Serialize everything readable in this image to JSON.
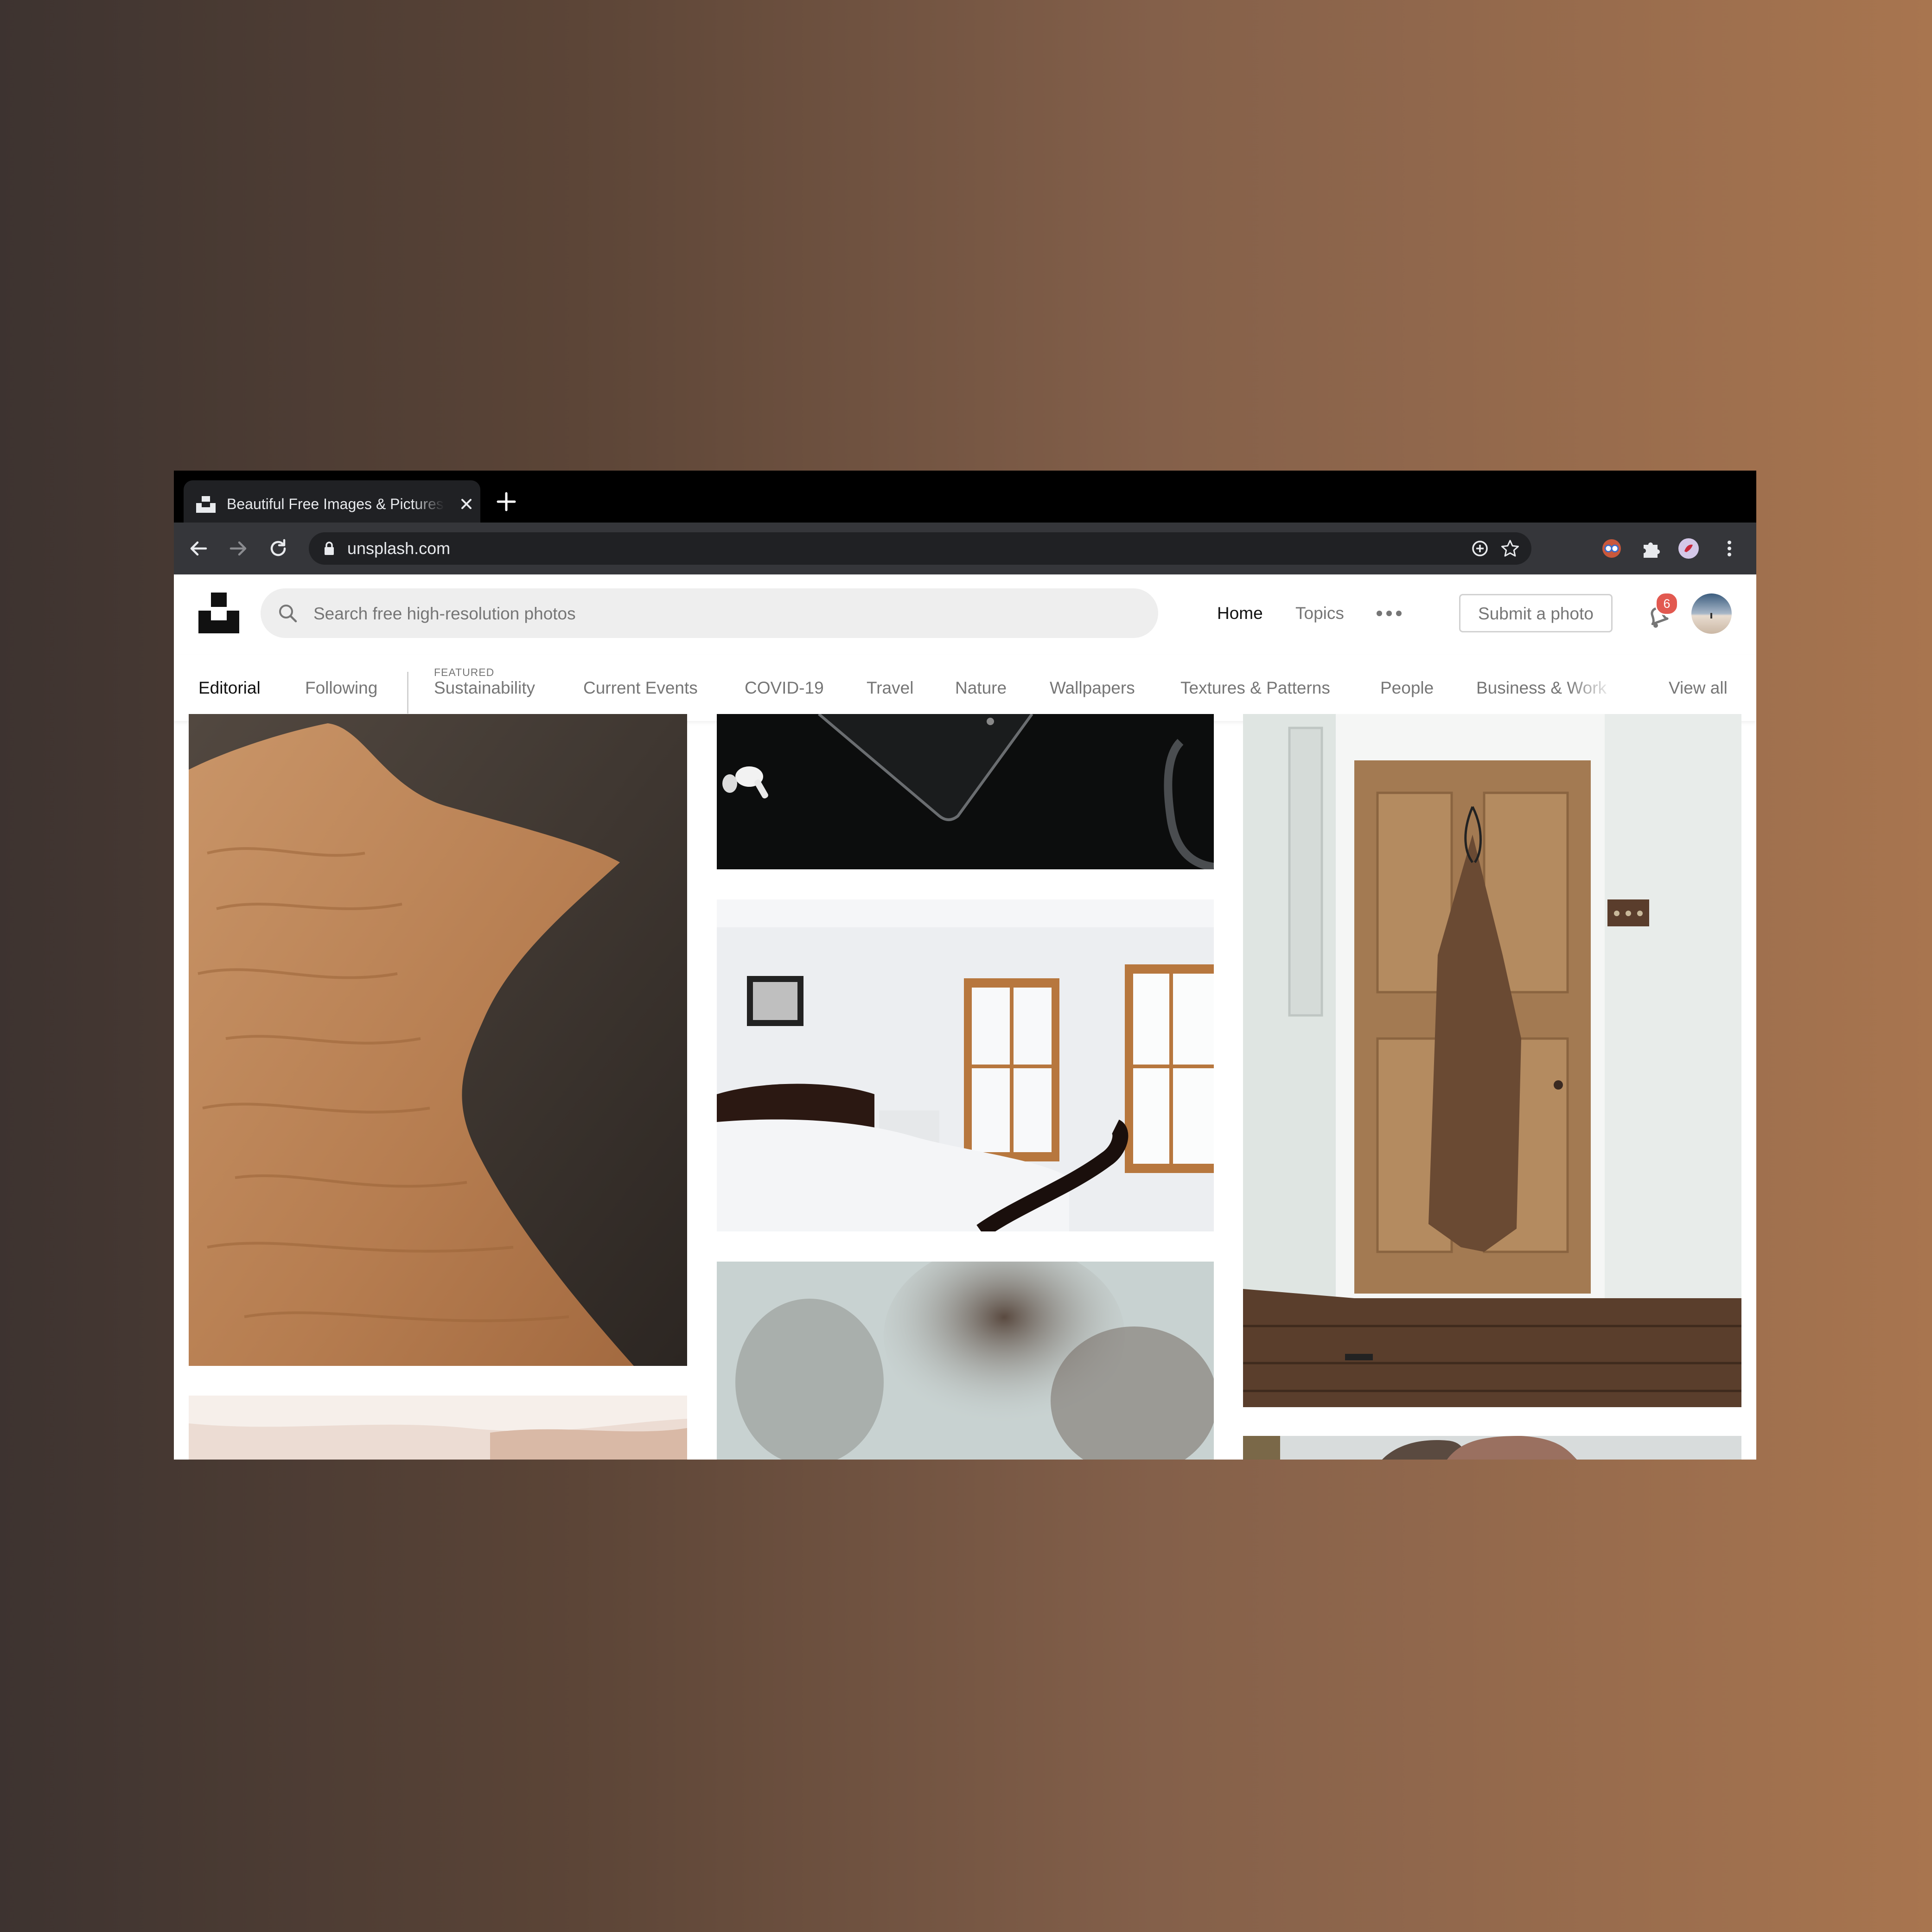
{
  "browser": {
    "tab_title": "Beautiful Free Images & Pictures | Unsplash",
    "url": "unsplash.com"
  },
  "header": {
    "search_placeholder": "Search free high-resolution photos",
    "nav": {
      "home": "Home",
      "topics": "Topics"
    },
    "submit_label": "Submit a photo",
    "notification_count": "6"
  },
  "topics": {
    "featured_label": "FEATURED",
    "editorial": "Editorial",
    "following": "Following",
    "items": [
      "Sustainability",
      "Current Events",
      "COVID-19",
      "Travel",
      "Nature",
      "Wallpapers",
      "Textures & Patterns",
      "People",
      "Business & Work"
    ],
    "view_all": "View all"
  },
  "photos": {
    "col1": [
      "sand-dune-photo",
      "beach-shore-photo"
    ],
    "col2": [
      "tablet-airpods-photo",
      "bedroom-photo",
      "blurred-foliage-photo"
    ],
    "col3": [
      "wooden-door-apron-photo",
      "portrait-photo"
    ]
  },
  "colors": {
    "chrome_dark": "#35363a",
    "badge_red": "#e25950",
    "text_dark": "#111111",
    "text_muted": "#767676"
  }
}
